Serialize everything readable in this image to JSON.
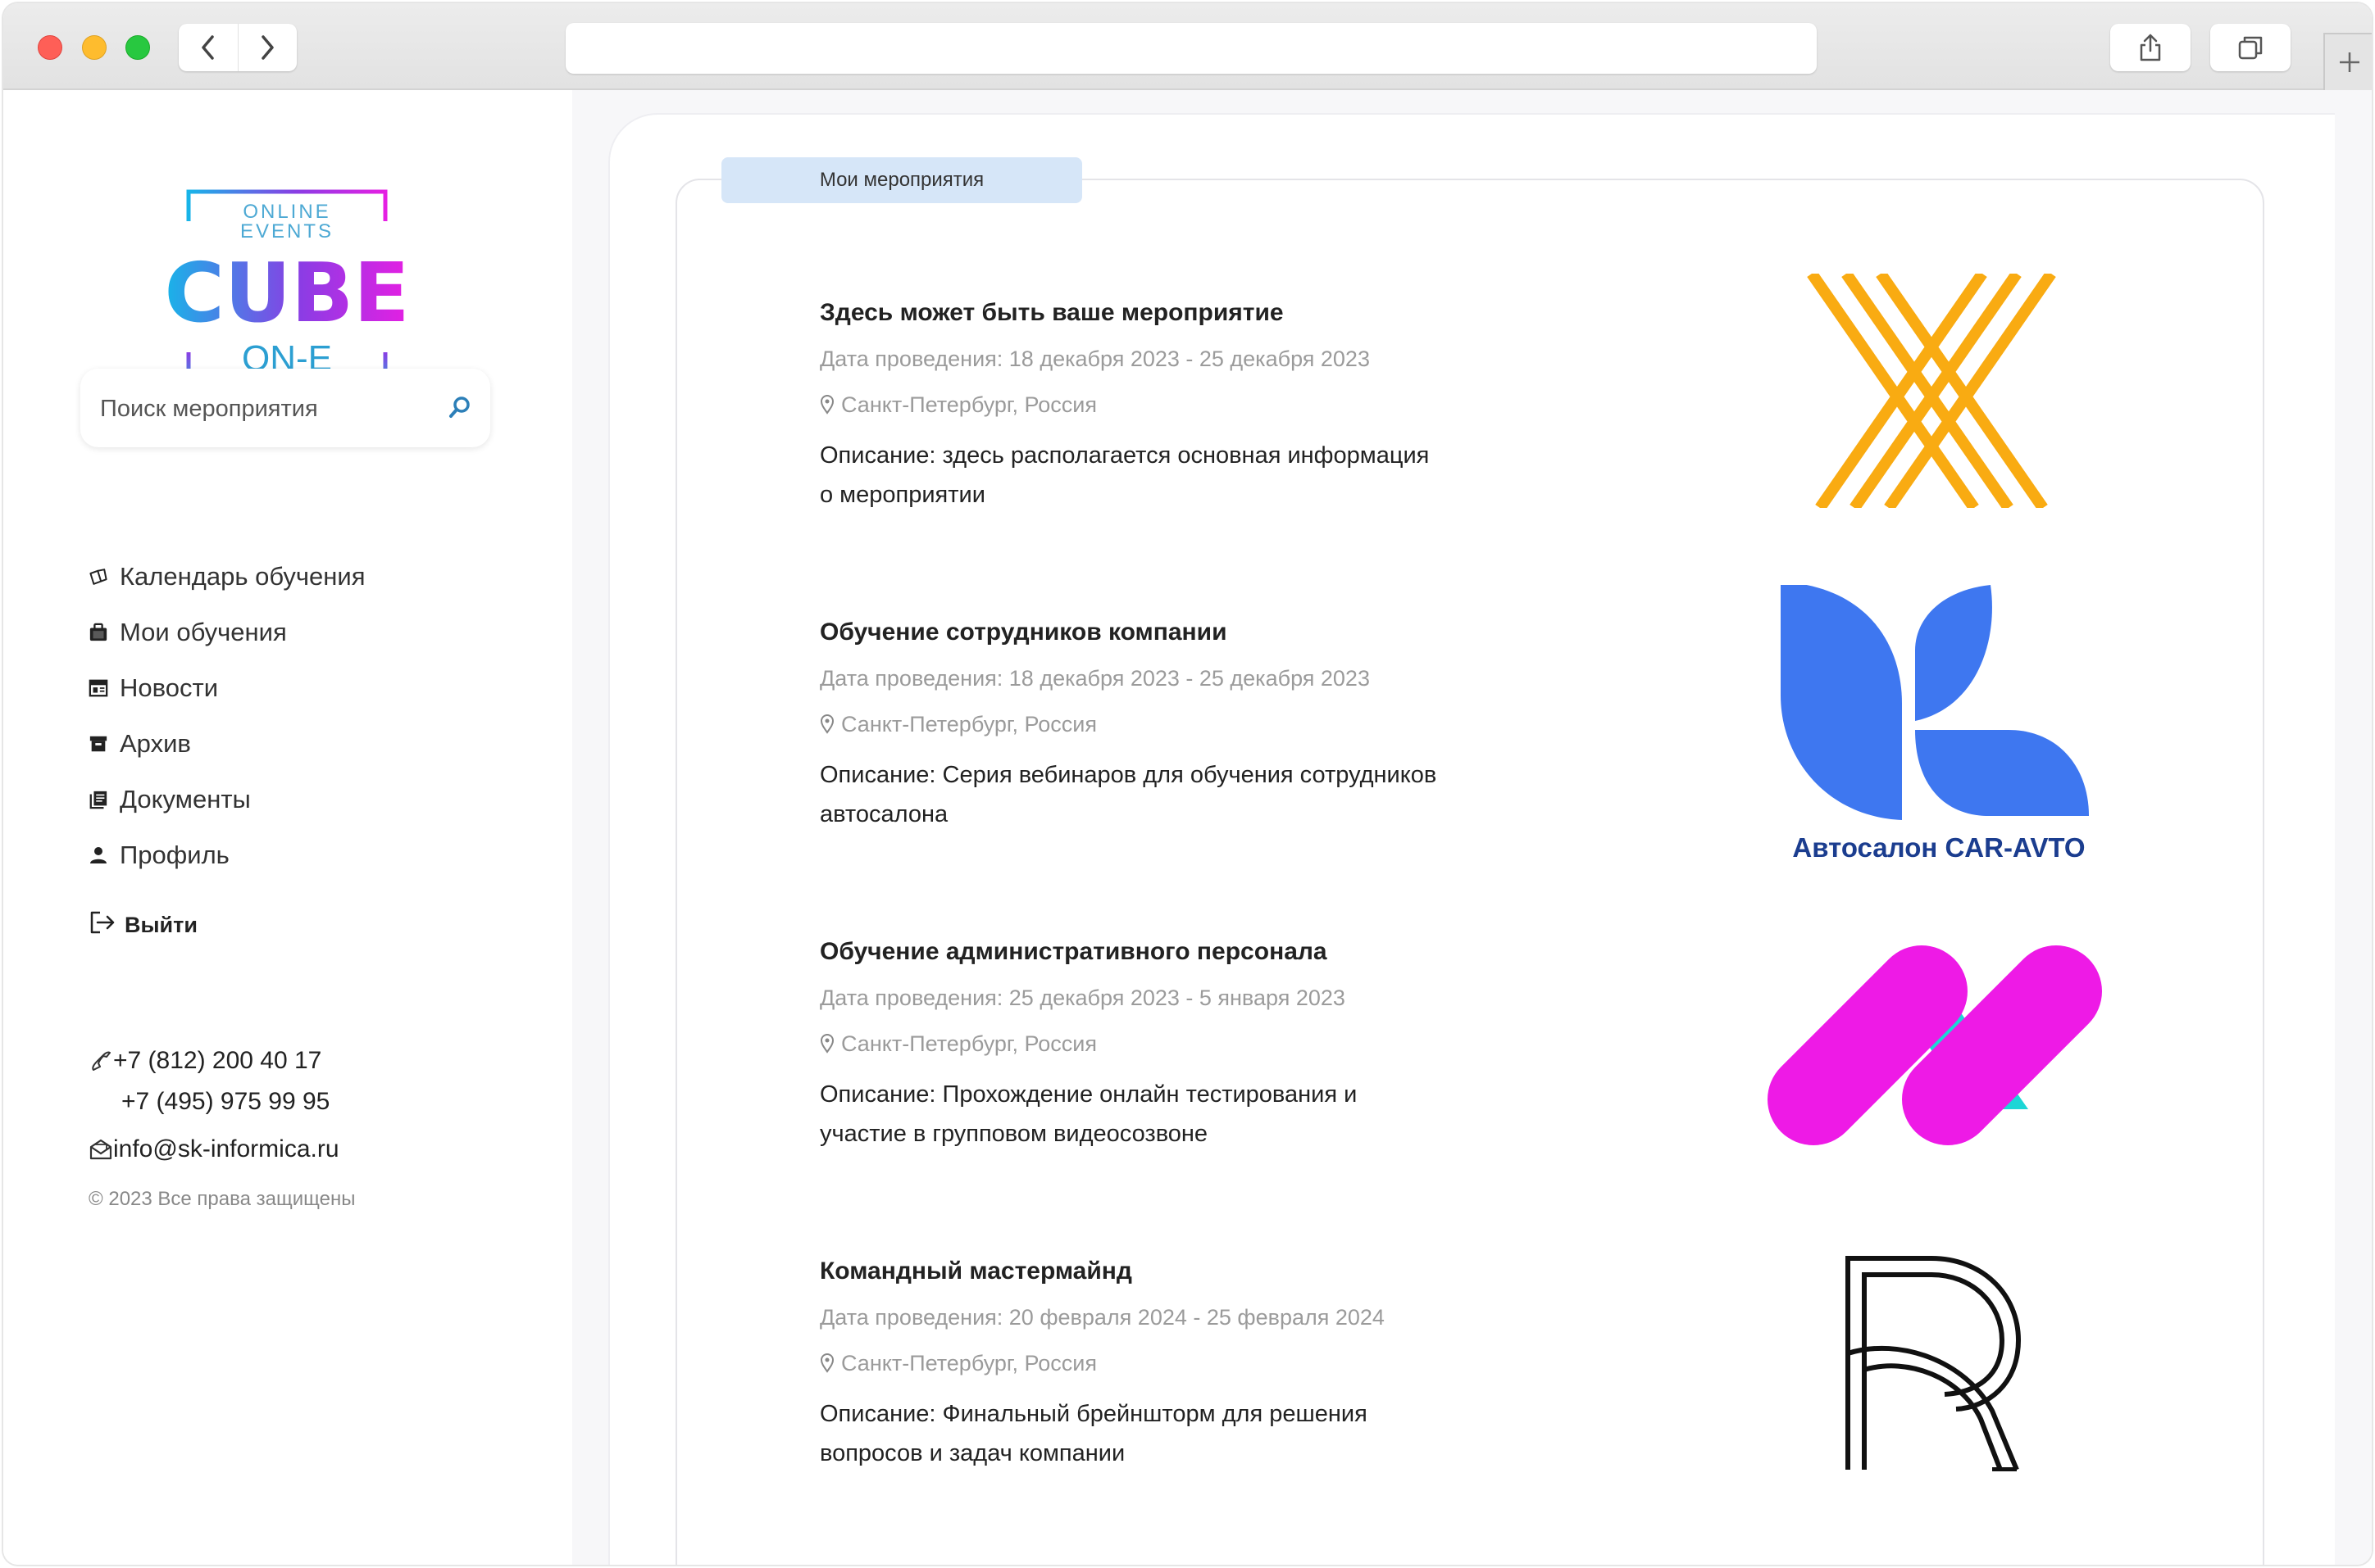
{
  "browser": {
    "address_text": ""
  },
  "sidebar": {
    "logo": {
      "top_text": "ONLINE EVENTS",
      "main_text": "CUBE",
      "bottom_text": "ON-E",
      "colors": [
        "#18b4e8",
        "#a033e0",
        "#e020e0"
      ]
    },
    "search": {
      "placeholder": "Поиск мероприятия",
      "value": ""
    },
    "menu": [
      {
        "label": "Календарь обучения",
        "icon": "calendar-tickets-icon"
      },
      {
        "label": "Мои обучения",
        "icon": "briefcase-icon"
      },
      {
        "label": "Новости",
        "icon": "newspaper-icon"
      },
      {
        "label": "Архив",
        "icon": "archive-box-icon"
      },
      {
        "label": "Документы",
        "icon": "documents-icon"
      },
      {
        "label": "Профиль",
        "icon": "user-icon"
      }
    ],
    "logout_label": "Выйти",
    "contacts": {
      "phone1": "+7 (812) 200 40 17",
      "phone2": "+7 (495) 975 99 95",
      "email": "info@sk-informica.ru"
    },
    "copyright": "© 2023 Все права защищены"
  },
  "main": {
    "tab_label": "Мои мероприятия",
    "events": [
      {
        "title": "Здесь может быть ваше мероприятие",
        "date": "Дата проведения: 18 декабря 2023 - 25 декабря 2023",
        "location": "Санкт-Петербург, Россия",
        "description": "Описание: здесь располагается основная информация о мероприятии",
        "logo": "orange-striped-x-logo"
      },
      {
        "title": "Обучение сотрудников компании",
        "date": "Дата проведения: 18 декабря 2023 - 25 декабря 2023",
        "location": "Санкт-Петербург, Россия",
        "description": "Описание: Серия вебинаров для обучения сотрудников автосалона",
        "logo": "car-avto-leaf-logo",
        "logo_text": "Автосалон CAR-AVTO"
      },
      {
        "title": "Обучение административного персонала",
        "date": "Дата проведения: 25 декабря 2023 - 5 января 2023",
        "location": "Санкт-Петербург, Россия",
        "description": "Описание: Прохождение онлайн тестирования и участие в групповом видеосозвоне",
        "logo": "magenta-n-logo"
      },
      {
        "title": "Командный мастермайнд",
        "date": "Дата проведения: 20 февраля 2024 - 25 февраля 2024",
        "location": "Санкт-Петербург, Россия",
        "description": "Описание: Финальный брейншторм для решения вопросов и задач компании",
        "logo": "outline-r-logo"
      }
    ]
  },
  "colors": {
    "tab_bg": "#d6e6f8",
    "orange": "#f9ab12",
    "blue": "#3e77f0",
    "navy": "#1b3d8f",
    "magenta": "#ee1ae6",
    "cyan": "#1cd6d6"
  }
}
